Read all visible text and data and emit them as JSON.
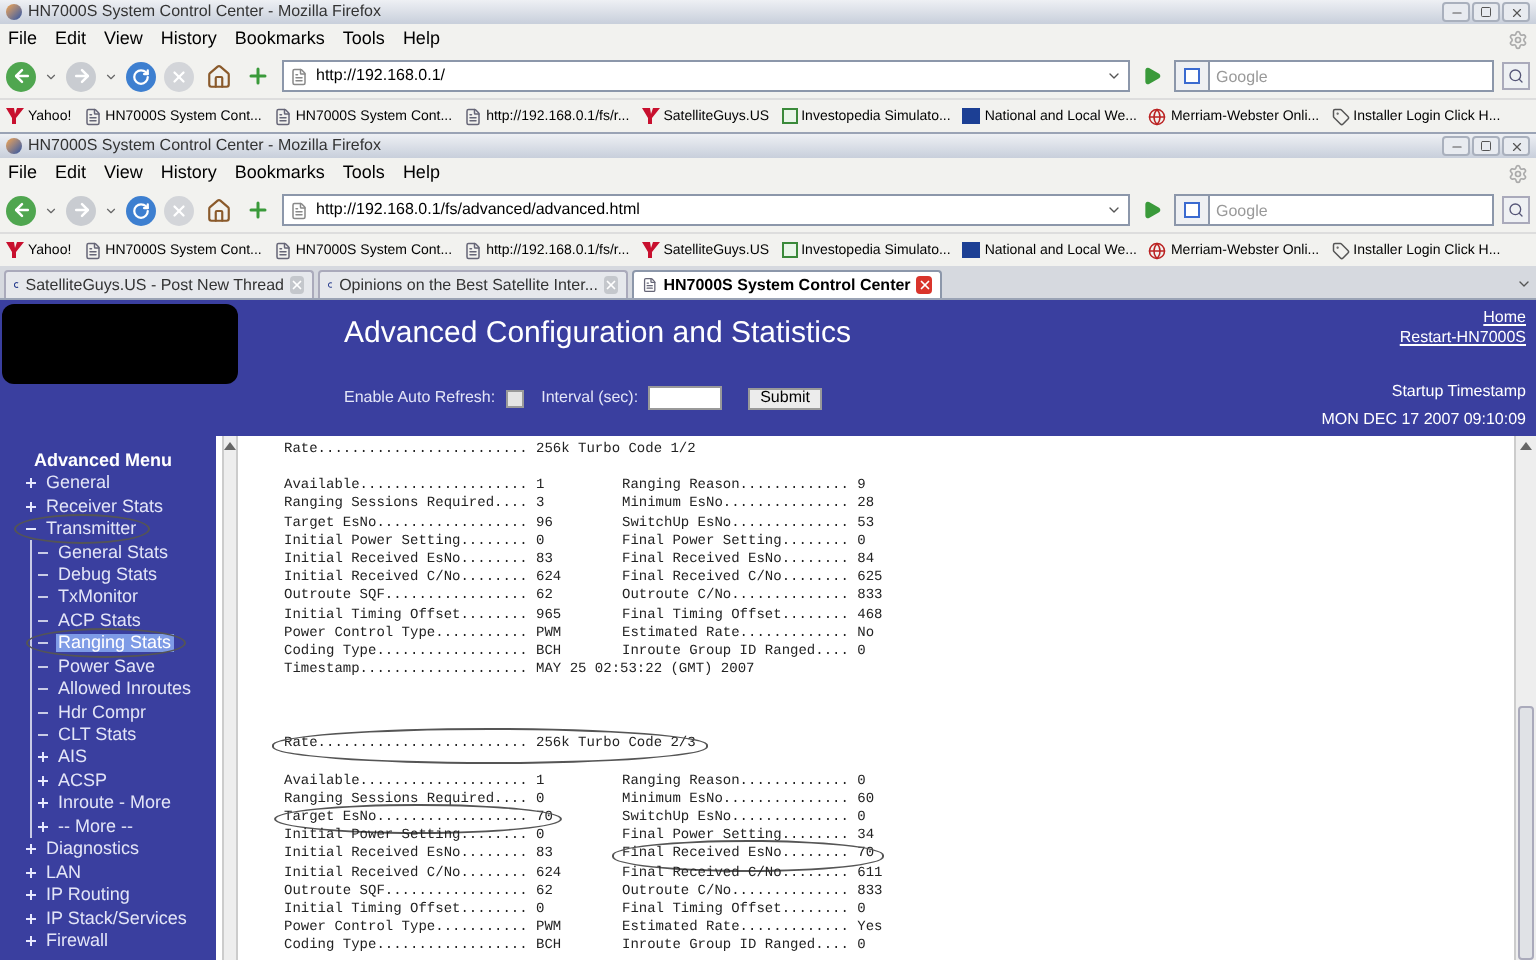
{
  "windows": [
    {
      "title": "HN7000S System Control Center - Mozilla Firefox",
      "menu": [
        "File",
        "Edit",
        "View",
        "History",
        "Bookmarks",
        "Tools",
        "Help"
      ],
      "address": "http://192.168.0.1/",
      "search": {
        "placeholder": "Google"
      },
      "bookmarks": [
        {
          "kind": "yahoo",
          "label": "Yahoo!"
        },
        {
          "kind": "page",
          "label": "HN7000S System Cont..."
        },
        {
          "kind": "page",
          "label": "HN7000S System Cont..."
        },
        {
          "kind": "page",
          "label": "http://192.168.0.1/fs/r..."
        },
        {
          "kind": "yahoo",
          "label": "SatelliteGuys.US"
        },
        {
          "kind": "google",
          "label": "Investopedia Simulato..."
        },
        {
          "kind": "tmc",
          "label": "National and Local We..."
        },
        {
          "kind": "globe",
          "label": "Merriam-Webster Onli..."
        },
        {
          "kind": "tag",
          "label": "Installer Login Click H..."
        }
      ]
    },
    {
      "title": "HN7000S System Control Center - Mozilla Firefox",
      "menu": [
        "File",
        "Edit",
        "View",
        "History",
        "Bookmarks",
        "Tools",
        "Help"
      ],
      "address": "http://192.168.0.1/fs/advanced/advanced.html",
      "search": {
        "placeholder": "Google"
      },
      "bookmarks": [
        {
          "kind": "yahoo",
          "label": "Yahoo!"
        },
        {
          "kind": "page",
          "label": "HN7000S System Cont..."
        },
        {
          "kind": "page",
          "label": "HN7000S System Cont..."
        },
        {
          "kind": "page",
          "label": "http://192.168.0.1/fs/r..."
        },
        {
          "kind": "yahoo",
          "label": "SatelliteGuys.US"
        },
        {
          "kind": "google",
          "label": "Investopedia Simulato..."
        },
        {
          "kind": "tmc",
          "label": "National and Local We..."
        },
        {
          "kind": "globe",
          "label": "Merriam-Webster Onli..."
        },
        {
          "kind": "tag",
          "label": "Installer Login Click H..."
        }
      ],
      "tabs": [
        {
          "kind": "swirl",
          "label": "SatelliteGuys.US - Post New Thread",
          "selected": false
        },
        {
          "kind": "swirl",
          "label": "Opinions on the Best Satellite Inter...",
          "selected": false
        },
        {
          "kind": "page",
          "label": "HN7000S System Control Center",
          "selected": true
        }
      ]
    }
  ],
  "page": {
    "header": {
      "title": "Advanced Configuration and Statistics",
      "auto_refresh": {
        "label": "Enable Auto Refresh:",
        "checked": false
      },
      "interval": {
        "label": "Interval (sec):"
      },
      "submit": "Submit",
      "links": [
        "Home",
        "Restart-HN7000S"
      ],
      "startup_label": "Startup Timestamp",
      "startup_value": "MON DEC 17 2007 09:10:09"
    },
    "sidebar": {
      "heading": "Advanced Menu",
      "items": [
        {
          "kind": "folder",
          "label": "General",
          "expanded": false,
          "selected": false,
          "circled": false
        },
        {
          "kind": "folder",
          "label": "Receiver Stats",
          "expanded": false,
          "selected": false,
          "circled": false
        },
        {
          "kind": "folder",
          "label": "Transmitter",
          "expanded": true,
          "selected": false,
          "circled": true,
          "children": [
            {
              "kind": "page",
              "label": "General Stats",
              "selected": false,
              "circled": false
            },
            {
              "kind": "page",
              "label": "Debug Stats",
              "selected": false,
              "circled": false
            },
            {
              "kind": "page",
              "label": "TxMonitor",
              "selected": false,
              "circled": false
            },
            {
              "kind": "page",
              "label": "ACP Stats",
              "selected": false,
              "circled": false
            },
            {
              "kind": "page",
              "label": "Ranging Stats",
              "selected": true,
              "circled": true
            },
            {
              "kind": "page",
              "label": "Power Save",
              "selected": false,
              "circled": false
            },
            {
              "kind": "page",
              "label": "Allowed Inroutes",
              "selected": false,
              "circled": false
            },
            {
              "kind": "page",
              "label": "Hdr Compr",
              "selected": false,
              "circled": false
            },
            {
              "kind": "page",
              "label": "CLT Stats",
              "selected": false,
              "circled": false
            },
            {
              "kind": "folder",
              "label": "AIS",
              "expanded": false,
              "selected": false,
              "circled": false
            },
            {
              "kind": "folder",
              "label": "ACSP",
              "expanded": false,
              "selected": false,
              "circled": false
            },
            {
              "kind": "folder",
              "label": "Inroute - More",
              "expanded": false,
              "selected": false,
              "circled": false
            },
            {
              "kind": "folder",
              "label": "-- More --",
              "expanded": false,
              "selected": false,
              "circled": false
            }
          ]
        },
        {
          "kind": "folder",
          "label": "Diagnostics",
          "expanded": false,
          "selected": false,
          "circled": false
        },
        {
          "kind": "folder",
          "label": "LAN",
          "expanded": false,
          "selected": false,
          "circled": false
        },
        {
          "kind": "folder",
          "label": "IP Routing",
          "expanded": false,
          "selected": false,
          "circled": false
        },
        {
          "kind": "folder",
          "label": "IP Stack/Services",
          "expanded": false,
          "selected": false,
          "circled": false
        },
        {
          "kind": "folder",
          "label": "Firewall",
          "expanded": false,
          "selected": false,
          "circled": false
        }
      ]
    },
    "blocks": [
      {
        "rate": "Rate......................... 256k Turbo Code 1/2",
        "rate_circled": false,
        "rows": [
          {
            "left": "Available.................... 1",
            "right": "Ranging Reason............. 9",
            "left_circled": false,
            "right_circled": false
          },
          {
            "left": "Ranging Sessions Required.... 3",
            "right": "Minimum EsNo............... 28",
            "left_circled": false,
            "right_circled": false
          },
          {
            "left": "Target EsNo.................. 96",
            "right": "SwitchUp EsNo.............. 53",
            "left_circled": false,
            "right_circled": false
          },
          {
            "left": "Initial Power Setting........ 0",
            "right": "Final Power Setting........ 0",
            "left_circled": false,
            "right_circled": false
          },
          {
            "left": "Initial Received EsNo........ 83",
            "right": "Final Received EsNo........ 84",
            "left_circled": false,
            "right_circled": false
          },
          {
            "left": "Initial Received C/No........ 624",
            "right": "Final Received C/No........ 625",
            "left_circled": false,
            "right_circled": false
          },
          {
            "left": "Outroute SQF................. 62",
            "right": "Outroute C/No.............. 833",
            "left_circled": false,
            "right_circled": false
          },
          {
            "left": "Initial Timing Offset........ 965",
            "right": "Final Timing Offset........ 468",
            "left_circled": false,
            "right_circled": false
          },
          {
            "left": "Power Control Type........... PWM",
            "right": "Estimated Rate............. No",
            "left_circled": false,
            "right_circled": false
          },
          {
            "left": "Coding Type.................. BCH",
            "right": "Inroute Group ID Ranged.... 0",
            "left_circled": false,
            "right_circled": false
          }
        ],
        "timestamp": "Timestamp.................... MAY 25 02:53:22 (GMT) 2007"
      },
      {
        "rate": "Rate......................... 256k Turbo Code 2/3",
        "rate_circled": true,
        "rows": [
          {
            "left": "Available.................... 1",
            "right": "Ranging Reason............. 0",
            "left_circled": false,
            "right_circled": false
          },
          {
            "left": "Ranging Sessions Required.... 0",
            "right": "Minimum EsNo............... 60",
            "left_circled": false,
            "right_circled": false
          },
          {
            "left": "Target EsNo.................. 70",
            "right": "SwitchUp EsNo.............. 0",
            "left_circled": true,
            "right_circled": false
          },
          {
            "left": "Initial Power Setting........ 0",
            "right": "Final Power Setting........ 34",
            "left_circled": false,
            "right_circled": false
          },
          {
            "left": "Initial Received EsNo........ 83",
            "right": "Final Received EsNo........ 70",
            "left_circled": false,
            "right_circled": true
          },
          {
            "left": "Initial Received C/No........ 624",
            "right": "Final Received C/No........ 611",
            "left_circled": false,
            "right_circled": false
          },
          {
            "left": "Outroute SQF................. 62",
            "right": "Outroute C/No.............. 833",
            "left_circled": false,
            "right_circled": false
          },
          {
            "left": "Initial Timing Offset........ 0",
            "right": "Final Timing Offset........ 0",
            "left_circled": false,
            "right_circled": false
          },
          {
            "left": "Power Control Type........... PWM",
            "right": "Estimated Rate............. Yes",
            "left_circled": false,
            "right_circled": false
          },
          {
            "left": "Coding Type.................. BCH",
            "right": "Inroute Group ID Ranged.... 0",
            "left_circled": false,
            "right_circled": false
          }
        ]
      }
    ]
  }
}
